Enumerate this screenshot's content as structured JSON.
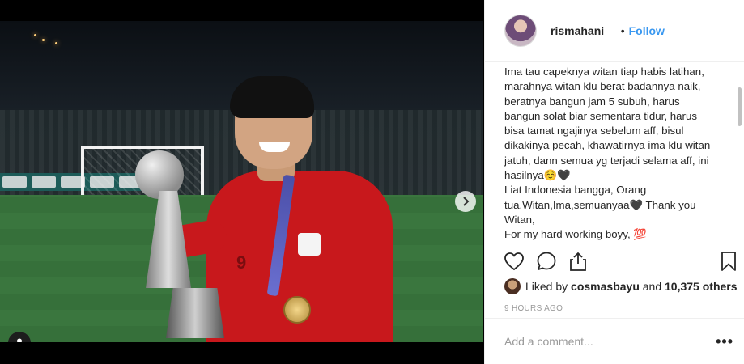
{
  "post": {
    "username": "rismahani__",
    "separator": "•",
    "follow_label": "Follow",
    "jersey_number": "9",
    "caption": "Ima tau capeknya witan tiap habis latihan,\nmarahnya witan klu berat badannya naik,\nberatnya bangun jam 5 subuh, harus\nbangun solat biar sementara tidur, harus\nbisa tamat ngajinya sebelum aff, bisul\ndikakinya pecah, khawatirnya ima klu witan\njatuh, dann semua yg terjadi selama aff, ini\nhasilnya☺️🖤\nLiat Indonesia bangga, Orang\ntua,Witan,Ima,semuanyaa🖤 Thank you\nWitan,\nFor my hard working boyy, 💯",
    "likes_prefix": "Liked by",
    "likes_user": "cosmasbayu",
    "likes_conjunction": "and",
    "likes_count": "10,375 others",
    "time_label": "9 HOURS AGO",
    "comment_placeholder": "Add a comment...",
    "more_label": "•••",
    "carousel": {
      "slides": 3,
      "active_index": 0
    }
  },
  "icons": {
    "next": "chevron-right-icon",
    "user_tag": "user-tag-icon",
    "like": "heart-icon",
    "comment": "comment-icon",
    "share": "share-icon",
    "save": "bookmark-icon"
  },
  "colors": {
    "accent": "#3897f0",
    "text": "#262626",
    "muted": "#999999",
    "border": "#efefef"
  }
}
